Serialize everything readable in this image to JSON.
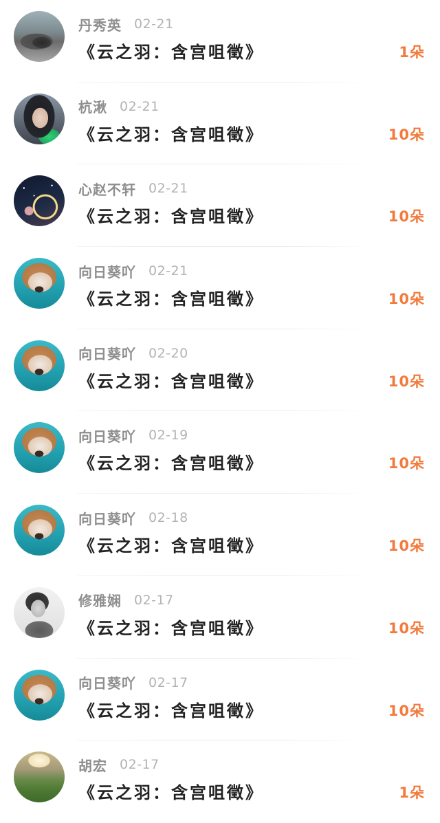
{
  "items": [
    {
      "user": "丹秀英",
      "date": "02-21",
      "title": "《云之羽：含宫咀徵》",
      "count": "1朵",
      "avatar": "car-avatar"
    },
    {
      "user": "杭湫",
      "date": "02-21",
      "title": "《云之羽：含宫咀徵》",
      "count": "10朵",
      "avatar": "girl-avatar"
    },
    {
      "user": "心赵不轩",
      "date": "02-21",
      "title": "《云之羽：含宫咀徵》",
      "count": "10朵",
      "avatar": "moon-avatar"
    },
    {
      "user": "向日葵吖",
      "date": "02-21",
      "title": "《云之羽：含宫咀徵》",
      "count": "10朵",
      "avatar": "dog-avatar"
    },
    {
      "user": "向日葵吖",
      "date": "02-20",
      "title": "《云之羽：含宫咀徵》",
      "count": "10朵",
      "avatar": "dog-avatar"
    },
    {
      "user": "向日葵吖",
      "date": "02-19",
      "title": "《云之羽：含宫咀徵》",
      "count": "10朵",
      "avatar": "dog-avatar"
    },
    {
      "user": "向日葵吖",
      "date": "02-18",
      "title": "《云之羽：含宫咀徵》",
      "count": "10朵",
      "avatar": "dog-avatar"
    },
    {
      "user": "修雅娴",
      "date": "02-17",
      "title": "《云之羽：含宫咀徵》",
      "count": "10朵",
      "avatar": "bw-portrait-avatar"
    },
    {
      "user": "向日葵吖",
      "date": "02-17",
      "title": "《云之羽：含宫咀徵》",
      "count": "10朵",
      "avatar": "dog-avatar"
    },
    {
      "user": "胡宏",
      "date": "02-17",
      "title": "《云之羽：含宫咀徵》",
      "count": "1朵",
      "avatar": "field-avatar"
    }
  ],
  "colors": {
    "count": "#f27a3c",
    "username": "#8e8e8e",
    "date": "#b3b3b3",
    "title": "#222222"
  }
}
